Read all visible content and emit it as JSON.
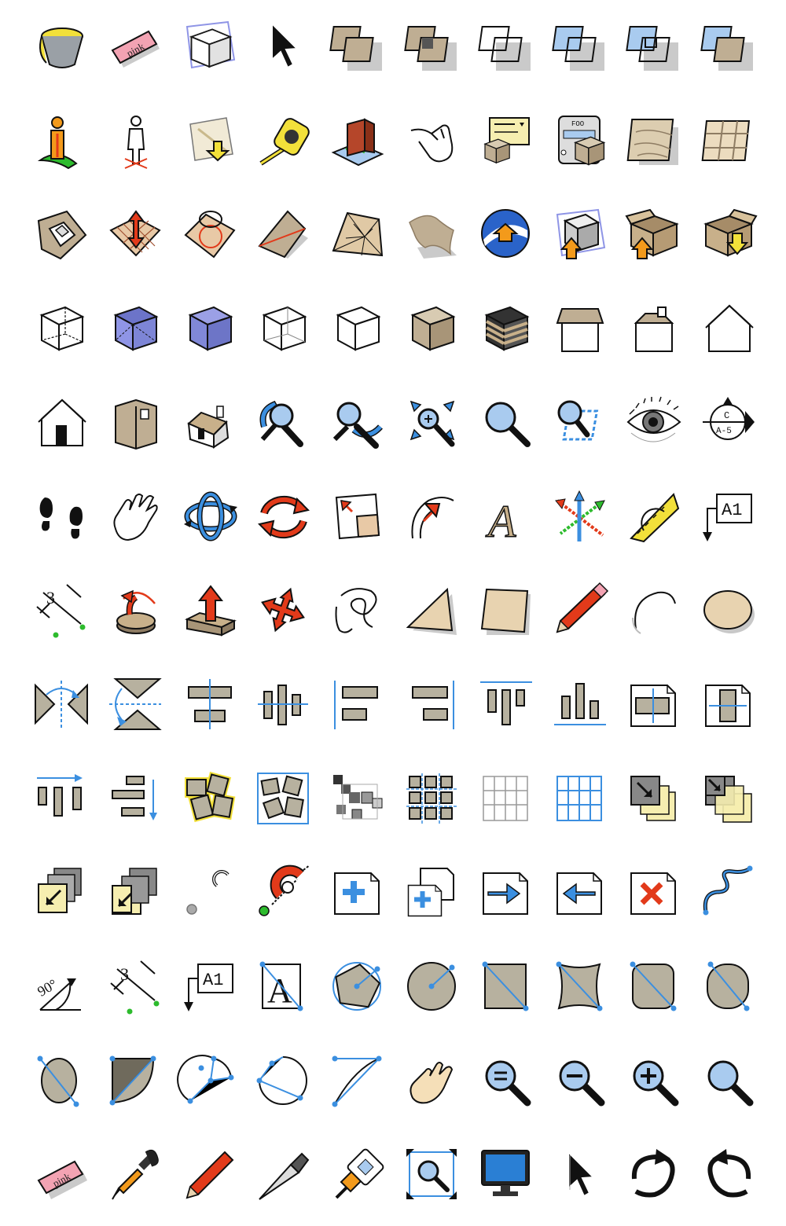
{
  "colors": {
    "tan": "#bfae93",
    "tan_dark": "#8e7c63",
    "gray_shape": "#b7b19f",
    "blue": "#3b8fe0",
    "blue_light": "#a9cbef",
    "red": "#e23a1a",
    "orange": "#f39a1b",
    "yellow": "#f2e03a",
    "green": "#2dbb2d",
    "black": "#111111",
    "shadow": "#bdbdbd",
    "pink": "#f3a3b3",
    "lavender": "#8f95e6",
    "note_yellow": "#f6eeb0"
  },
  "texts": {
    "eraser_top": "pink",
    "eraser_bottom": "pink",
    "section_top": "C",
    "section_bottom": "A-5",
    "label_a1": "A1",
    "label_a1_b": "A1",
    "text_a": "A",
    "text_3d_a": "A",
    "dim_3": "3",
    "dim_3_b": "3",
    "angle_90": "90°",
    "foo": "FOO"
  },
  "icons": [
    "paint-bucket-icon",
    "eraser-icon",
    "select-box-icon",
    "arrow-cursor-icon",
    "union-solids-icon",
    "subtract-solids-icon",
    "outer-shell-icon",
    "intersect-solids-icon",
    "split-solids-icon",
    "trim-solids-icon",
    "position-camera-icon",
    "walk-person-icon",
    "add-location-icon",
    "tape-measure-icon",
    "building-3d-icon",
    "hand-pinch-icon",
    "component-options-icon",
    "component-attributes-icon",
    "sandbox-from-contours-icon",
    "sandbox-from-scratch-icon",
    "stamp-icon",
    "smoove-icon",
    "drape-icon",
    "flip-edge-icon",
    "add-detail-icon",
    "terrain-icon",
    "earth-upload-icon",
    "share-model-icon",
    "box-share-icon",
    "box-download-icon",
    "xray-cube-icon",
    "back-edges-cube-icon",
    "shaded-cube-icon",
    "wireframe-cube-icon",
    "hidden-line-cube-icon",
    "shaded-solid-cube-icon",
    "textured-cube-icon",
    "top-view-icon",
    "front-view-icon",
    "house-outline-icon",
    "iso-house-icon",
    "box-iso-icon",
    "house-3d-icon",
    "orbit-zoom-icon",
    "orbit-zoom-alt-icon",
    "zoom-extents-icon",
    "zoom-magnifier-icon",
    "zoom-window-icon",
    "look-around-eye-icon",
    "section-label-icon",
    "footprints-icon",
    "pan-hand-icon",
    "orbit-arrows-icon",
    "rotate-arrows-icon",
    "scale-icon",
    "protractor-arc-icon",
    "3d-text-icon",
    "axes-icon",
    "protractor-icon",
    "text-label-icon",
    "dimension-icon",
    "rotate-face-icon",
    "push-pull-icon",
    "move-icon",
    "freehand-icon",
    "polygon-icon",
    "rectangle-icon",
    "pencil-icon",
    "arc-icon",
    "circle-icon",
    "flip-horizontal-icon",
    "flip-vertical-icon",
    "align-center-vertical-icon",
    "align-middle-icon",
    "align-left-icon",
    "align-right-icon",
    "align-top-icon",
    "align-bottom-icon",
    "center-horizontal-page-icon",
    "center-vertical-page-icon",
    "space-horizontal-icon",
    "space-vertical-icon",
    "group-icon",
    "selected-group-icon",
    "hierarchy-icon",
    "grid-shapes-icon",
    "grid-gray-icon",
    "grid-blue-icon",
    "send-to-back-icon",
    "send-backward-icon",
    "bring-forward-icon",
    "bring-to-front-icon",
    "snap-off-icon",
    "snap-magnet-icon",
    "add-page-icon",
    "duplicate-page-icon",
    "next-page-icon",
    "previous-page-icon",
    "delete-page-icon",
    "bezier-curve-icon",
    "angle-dimension-icon",
    "linear-dimension-icon",
    "text-label-b-icon",
    "text-box-icon",
    "polygon-circle-icon",
    "circle-radius-icon",
    "rectangle-diagonal-icon",
    "rounded-rectangle-icon",
    "rounded-rect-diagonal-icon",
    "ellipse-diagonal-icon",
    "ellipse-alt-icon",
    "pie-icon",
    "arc-3point-icon",
    "arc-2point-icon",
    "arc-2point-alt-icon",
    "pan-hand-color-icon",
    "zoom-fit-icon",
    "zoom-out-icon",
    "zoom-in-icon",
    "zoom-icon",
    "eraser-small-icon",
    "eyedropper-icon",
    "pencil-small-icon",
    "knife-icon",
    "glue-icon",
    "zoom-extents-b-icon",
    "monitor-icon",
    "pointer-icon",
    "redo-icon",
    "undo-icon"
  ]
}
